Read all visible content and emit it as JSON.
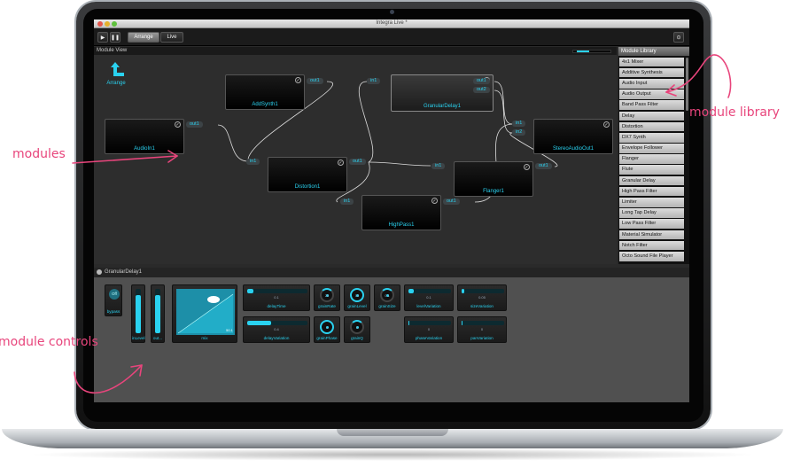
{
  "app": {
    "window_title": "Integra Live *",
    "toolbar": {
      "play_icon": "play-icon",
      "pause_icon": "pause-icon",
      "tab_arrange": "Arrange",
      "tab_live": "Live"
    },
    "module_view": {
      "title": "Module View",
      "arrange_label": "Arrange",
      "modules": [
        {
          "name": "AddSynth1",
          "outputs": [
            "out1"
          ],
          "inputs": []
        },
        {
          "name": "GranularDelay1",
          "outputs": [
            "out1",
            "out2"
          ],
          "inputs": [
            "in1"
          ]
        },
        {
          "name": "AudioIn1",
          "outputs": [
            "out1"
          ],
          "inputs": []
        },
        {
          "name": "StereoAudioOut1",
          "outputs": [],
          "inputs": [
            "in1",
            "in2"
          ]
        },
        {
          "name": "Distortion1",
          "outputs": [
            "out1"
          ],
          "inputs": [
            "in1"
          ]
        },
        {
          "name": "Flanger1",
          "outputs": [
            "out1"
          ],
          "inputs": [
            "in1"
          ]
        },
        {
          "name": "HighPass1",
          "outputs": [
            "out1"
          ],
          "inputs": [
            "in1"
          ]
        }
      ]
    },
    "module_library": {
      "title": "Module Library",
      "items": [
        "4x1 Mixer",
        "Additive Synthesis",
        "Audio Input",
        "Audio Output",
        "Band Pass Filter",
        "Delay",
        "Distortion",
        "DX7 Synth",
        "Envelope Follower",
        "Flanger",
        "Flute",
        "Granular Delay",
        "High Pass Filter",
        "Limiter",
        "Long Tap Delay",
        "Low Pass Filter",
        "Material Simulator",
        "Notch Filter",
        "Octo Sound File Player"
      ]
    },
    "controls": {
      "title": "GranularDelay1",
      "bypass": {
        "state": "Off",
        "label": "bypass"
      },
      "in_level": "inLevel",
      "out_level": "out...",
      "mix": {
        "label": "mix",
        "value": "50.1"
      },
      "delay_time": {
        "label": "delayTime",
        "value": "0.1"
      },
      "delay_variation": {
        "label": "delayVariation",
        "value": "0.4"
      },
      "grain_rate": {
        "label": "grainRate",
        "value": "20"
      },
      "grain_level": {
        "label": "grainLevel",
        "value": "10"
      },
      "grain_size": {
        "label": "grainSize",
        "value": "0.1"
      },
      "grain_phase": {
        "label": "grainPhase",
        "value": "1"
      },
      "grain_q": {
        "label": "grainQ",
        "value": "0"
      },
      "level_variation": {
        "label": "levelVariation",
        "value": "0.1"
      },
      "size_variation": {
        "label": "sizeVariation",
        "value": "0.05"
      },
      "phase_variation": {
        "label": "phaseVariation",
        "value": "0"
      },
      "pan_variation": {
        "label": "panVariation",
        "value": "0"
      }
    }
  },
  "annotations": {
    "modules": "modules",
    "module_library": "module library",
    "module_controls": "module controls",
    "color": "#e8457c"
  },
  "colors": {
    "accent": "#2ad2f0"
  }
}
